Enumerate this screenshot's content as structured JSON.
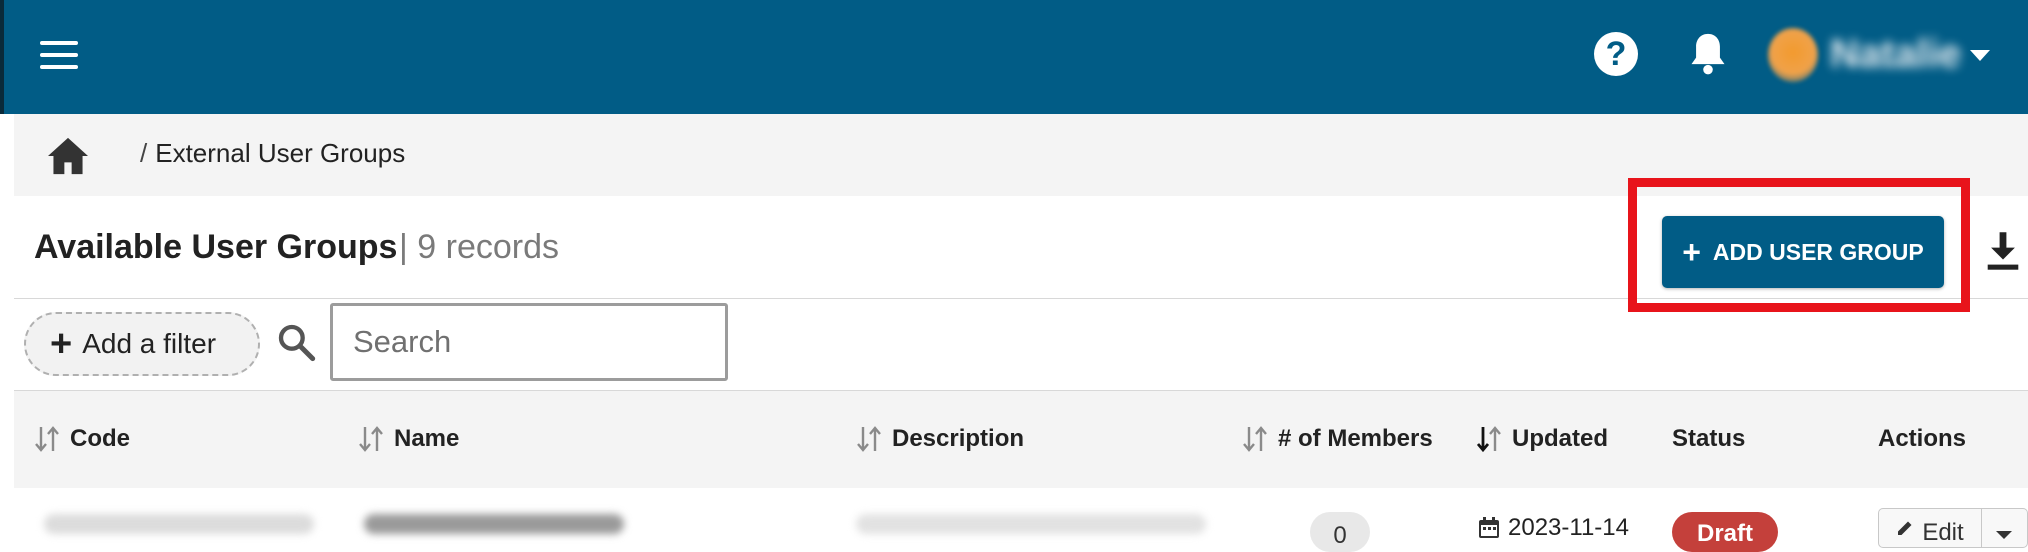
{
  "header": {
    "menu_icon": "hamburger-menu-icon",
    "help_label": "?",
    "user_name": "Natalie"
  },
  "breadcrumb": {
    "home_icon": "home-icon",
    "separator": "/",
    "current": "External User Groups"
  },
  "page": {
    "title": "Available User Groups",
    "records": "| 9 records",
    "add_button_label": "ADD USER GROUP",
    "add_button_plus": "+"
  },
  "filters": {
    "add_filter_plus": "+",
    "add_filter_label": "Add a filter",
    "search_placeholder": "Search"
  },
  "table": {
    "columns": [
      {
        "label": "Code"
      },
      {
        "label": "Name"
      },
      {
        "label": "Description"
      },
      {
        "label": "# of Members"
      },
      {
        "label": "Updated"
      },
      {
        "label": "Status"
      },
      {
        "label": "Actions"
      }
    ],
    "sorted_column": "Updated",
    "rows": [
      {
        "members": "0",
        "updated": "2023-11-14",
        "status": "Draft",
        "action": "Edit"
      }
    ]
  },
  "colors": {
    "brand": "#015c86",
    "highlight": "#e8141b",
    "status_draft": "#c4403b"
  }
}
